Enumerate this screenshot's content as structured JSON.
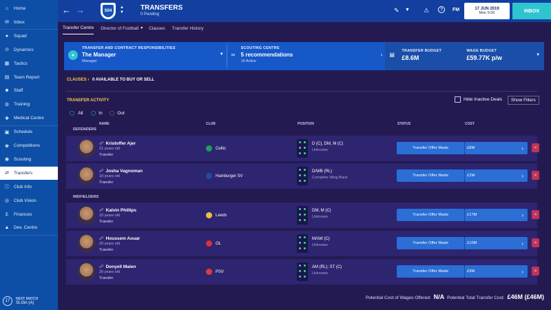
{
  "sidebar": {
    "items": [
      {
        "label": "Home",
        "icon": "home-icon"
      },
      {
        "label": "Inbox",
        "icon": "inbox-icon"
      },
      {
        "label": "Squad",
        "icon": "squad-icon"
      },
      {
        "label": "Dynamics",
        "icon": "dynamics-icon"
      },
      {
        "label": "Tactics",
        "icon": "tactics-icon"
      },
      {
        "label": "Team Report",
        "icon": "report-icon"
      },
      {
        "label": "Staff",
        "icon": "staff-icon"
      },
      {
        "label": "Training",
        "icon": "training-icon"
      },
      {
        "label": "Medical Centre",
        "icon": "medical-icon"
      },
      {
        "label": "Schedule",
        "icon": "schedule-icon"
      },
      {
        "label": "Competitions",
        "icon": "trophy-icon"
      },
      {
        "label": "Scouting",
        "icon": "scouting-icon"
      },
      {
        "label": "Transfers",
        "icon": "transfers-icon"
      },
      {
        "label": "Club Info",
        "icon": "info-icon"
      },
      {
        "label": "Club Vision",
        "icon": "vision-icon"
      },
      {
        "label": "Finances",
        "icon": "finance-icon"
      },
      {
        "label": "Dev. Centre",
        "icon": "dev-icon"
      }
    ],
    "next_match": {
      "heading": "NEXT MATCH",
      "opponent": "St.Gin (A)",
      "day": "17"
    }
  },
  "header": {
    "title": "TRANSFERS",
    "subtitle": "0 Pending",
    "date": "17 JUN 2019",
    "day_time": "Mon 9:00",
    "inbox_label": "INBOX",
    "fm_label": "FM"
  },
  "tabs": [
    "Transfer Centre",
    "Director of Football",
    "Clauses",
    "Transfer History"
  ],
  "summary": {
    "responsibilities_title": "TRANSFER AND CONTRACT RESPONSIBILITIES",
    "responsibilities_value": "The Manager",
    "responsibilities_sub": "Manager",
    "scouting_title": "SCOUTING CENTRE",
    "scouting_value": "5 recommendations",
    "scouting_sub": "10 Active",
    "budget_title": "TRANSFER BUDGET",
    "budget_value": "£8.6M",
    "wage_title": "WAGE BUDGET",
    "wage_value": "£59.77K p/w"
  },
  "clauses": {
    "label": "CLAUSES",
    "text": "0 AVAILABLE TO BUY OR SELL"
  },
  "activity": {
    "title": "TRANSFER ACTIVITY",
    "filters": [
      "All",
      "In",
      "Out"
    ],
    "hide_inactive": "Hide Inactive Deals",
    "show_filters": "Show Filters"
  },
  "columns": [
    "NAME",
    "CLUB",
    "POSITION",
    "STATUS",
    "COST"
  ],
  "sections": {
    "defenders": "DEFENDERS",
    "midfielders": "MIDFIELDERS"
  },
  "players": [
    {
      "name": "Kristoffer Ajer",
      "age": "21 years old",
      "type": "Transfer",
      "club": "Celtic",
      "club_color": "#1f9e5a",
      "position": "D (C), DM, M (C)",
      "role": "Unknown",
      "status": "Transfer Offer Made",
      "cost": "£8M"
    },
    {
      "name": "Josha Vagnoman",
      "age": "18 years old",
      "type": "Transfer",
      "club": "Hamburger SV",
      "club_color": "#1c4e9a",
      "position": "D/WB (RL)",
      "role": "Complete Wing-Back",
      "status": "Transfer Offer Made",
      "cost": "£2M"
    },
    {
      "name": "Kalvin Phillips",
      "age": "23 years old",
      "type": "Transfer",
      "club": "Leeds",
      "club_color": "#e8c23a",
      "position": "DM, M (C)",
      "role": "Unknown",
      "status": "Transfer Offer Made",
      "cost": "£17M"
    },
    {
      "name": "Houssem Aouar",
      "age": "20 years old",
      "type": "Transfer",
      "club": "OL",
      "club_color": "#d83040",
      "position": "M/AM (C)",
      "role": "Unknown",
      "status": "Transfer Offer Made",
      "cost": "£10M"
    },
    {
      "name": "Donyell Malen",
      "age": "20 years old",
      "type": "Transfer",
      "club": "PSV",
      "club_color": "#e03a3a",
      "position": "AM (RL); ST (C)",
      "role": "Unknown",
      "status": "Transfer Offer Made",
      "cost": "£9M"
    }
  ],
  "footer": {
    "wages_label": "Potential Cost of Wages Offered:",
    "wages_value": "N/A",
    "total_label": "Potential Total Transfer Cost:",
    "total_value": "£46M (£46M)"
  },
  "colors": {
    "sidebar": "#0d4fa6",
    "topbar": "#123fa0",
    "panel": "#241a52",
    "accent": "#2a6ed6",
    "inbox": "#2ec5cf",
    "gold": "#f2c94c"
  }
}
